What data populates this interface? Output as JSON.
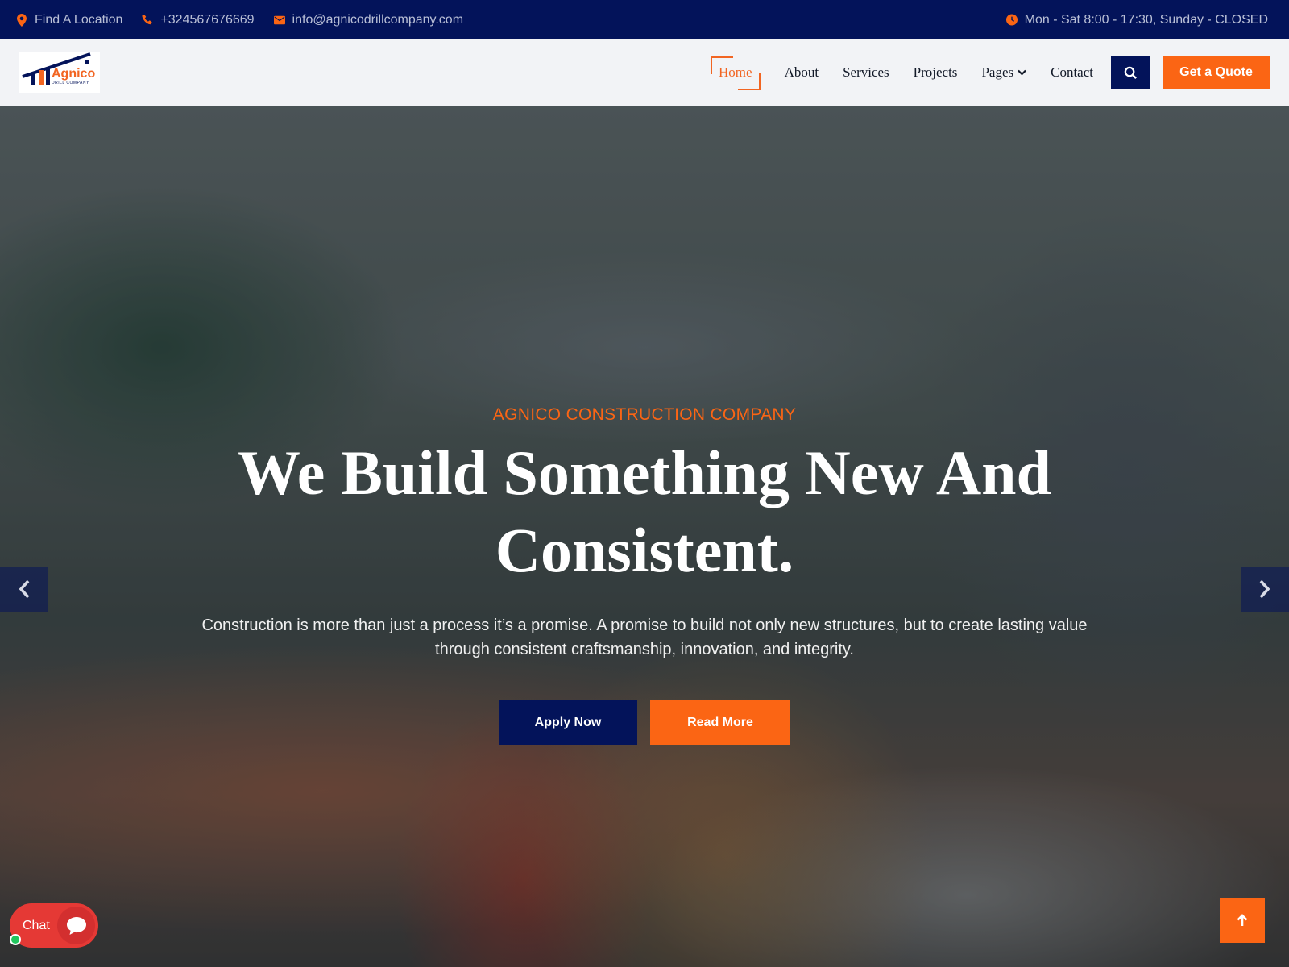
{
  "topbar": {
    "location": "Find A Location",
    "phone": "+324567676669",
    "email": "info@agnicodrillcompany.com",
    "hours": "Mon - Sat 8:00 - 17:30, Sunday - CLOSED",
    "icons": [
      "map-marker-icon",
      "phone-icon",
      "envelope-icon",
      "clock-icon"
    ],
    "icon_color": "#fb6514"
  },
  "logo": {
    "name": "Agnico",
    "sub": "DRILL COMPANY"
  },
  "nav": {
    "items": [
      {
        "label": "Home",
        "active": true
      },
      {
        "label": "About"
      },
      {
        "label": "Services"
      },
      {
        "label": "Projects"
      },
      {
        "label": "Pages"
      },
      {
        "label": "Contact"
      }
    ],
    "quote_label": "Get a Quote"
  },
  "hero": {
    "eyebrow": "AGNICO CONSTRUCTION COMPANY",
    "headline": "We Build Something New And Consistent.",
    "description": "Construction is more than just a process it’s a promise. A promise to build not only new structures, but to create lasting value through consistent craftsmanship, innovation, and integrity.",
    "apply_label": "Apply Now",
    "read_label": "Read More"
  },
  "chat": {
    "label": "Chat"
  },
  "colors": {
    "navy": "#03135a",
    "orange": "#fb6514"
  }
}
